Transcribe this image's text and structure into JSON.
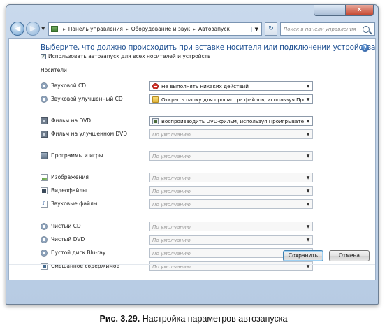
{
  "window": {
    "caption_buttons": {
      "close": "x"
    }
  },
  "navbar": {
    "address_parts": [
      "Панель управления",
      "Оборудование и звук",
      "Автозапуск"
    ],
    "search_placeholder": "Поиск в панели управления"
  },
  "content": {
    "heading": "Выберите, что должно происходить при вставке носителя или подключении устройства",
    "use_autoplay_label": "Использовать автозапуск для всех носителей и устройств",
    "use_autoplay_checked": true,
    "section_label": "Носители",
    "rows": [
      {
        "label": "Звуковой CD",
        "icon": "cd-disc-icon",
        "value": "Не выполнять никаких действий",
        "option_icon": "stop-icon",
        "disabled": false
      },
      {
        "label": "Звуковой улучшенный CD",
        "icon": "cd-disc-icon",
        "value": "Открыть папку для просмотра файлов, используя Пров",
        "option_icon": "folder-icon",
        "disabled": false
      },
      {
        "label": "Фильм на DVD",
        "icon": "dvd-film-icon",
        "value": "Воспроизводить DVD-фильм, используя Проигрывател",
        "option_icon": "media-player-icon",
        "disabled": false
      },
      {
        "label": "Фильм на улучшенном DVD",
        "icon": "dvd-film-icon",
        "value": "По умолчанию",
        "disabled": true
      },
      {
        "label": "Программы и игры",
        "icon": "software-box-icon",
        "value": "По умолчанию",
        "disabled": true
      },
      {
        "label": "Изображения",
        "icon": "picture-file-icon",
        "value": "По умолчанию",
        "disabled": true
      },
      {
        "label": "Видеофайлы",
        "icon": "video-file-icon",
        "value": "По умолчанию",
        "disabled": true
      },
      {
        "label": "Звуковые файлы",
        "icon": "audio-file-icon",
        "value": "По умолчанию",
        "disabled": true
      },
      {
        "label": "Чистый CD",
        "icon": "blank-cd-icon",
        "value": "По умолчанию",
        "disabled": true
      },
      {
        "label": "Чистый DVD",
        "icon": "blank-dvd-icon",
        "value": "По умолчанию",
        "disabled": true
      },
      {
        "label": "Пустой диск Blu-ray",
        "icon": "blank-bluray-icon",
        "value": "По умолчанию",
        "disabled": true
      },
      {
        "label": "Смешанное содержимое",
        "icon": "mixed-content-icon",
        "value": "По умолчанию",
        "disabled": true
      }
    ]
  },
  "buttons": {
    "save": "Сохранить",
    "cancel": "Отмена"
  },
  "caption": {
    "number": "Рис. 3.29.",
    "text": "Настройка параметров автозапуска"
  },
  "colors": {
    "heading": "#1d4f91",
    "window_frame": "#b7cbe3"
  }
}
